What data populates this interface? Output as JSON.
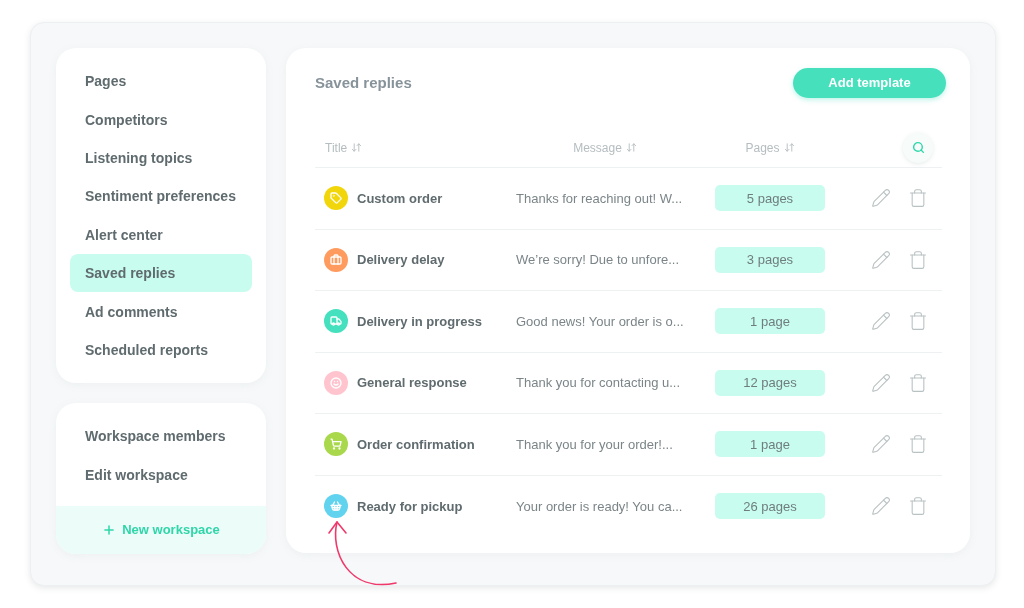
{
  "sidebar": {
    "nav_items": [
      {
        "label": "Pages",
        "selected": false
      },
      {
        "label": "Competitors",
        "selected": false
      },
      {
        "label": "Listening topics",
        "selected": false
      },
      {
        "label": "Sentiment preferences",
        "selected": false
      },
      {
        "label": "Alert center",
        "selected": false
      },
      {
        "label": "Saved replies",
        "selected": true
      },
      {
        "label": "Ad comments",
        "selected": false
      },
      {
        "label": "Scheduled reports",
        "selected": false
      }
    ],
    "workspace_items": [
      {
        "label": "Workspace members",
        "selected": false
      },
      {
        "label": "Edit workspace",
        "selected": false
      }
    ],
    "new_workspace": "New workspace"
  },
  "panel": {
    "title": "Saved replies",
    "add_button": "Add template",
    "columns": [
      {
        "label": "Title"
      },
      {
        "label": "Message"
      },
      {
        "label": "Pages"
      }
    ],
    "rows": [
      {
        "title": "Custom order",
        "message": "Thanks for reaching out! W...",
        "pages": "5 pages",
        "color": "#f2d60c"
      },
      {
        "title": "Delivery delay",
        "message": "We’re sorry! Due to unfore...",
        "pages": "3 pages",
        "color": "#ff9b5e"
      },
      {
        "title": "Delivery in progress",
        "message": "Good news! Your order is o...",
        "pages": "1 page",
        "color": "#45e0bd"
      },
      {
        "title": "General response",
        "message": "Thank you for contacting u...",
        "pages": "12 pages",
        "color": "#ffc4ce"
      },
      {
        "title": "Order confirmation",
        "message": "Thank you for your order!...",
        "pages": "1 page",
        "color": "#a9d84c"
      },
      {
        "title": "Ready for pickup",
        "message": "Your order is ready! You ca...",
        "pages": "26 pages",
        "color": "#61d3ef"
      }
    ]
  }
}
